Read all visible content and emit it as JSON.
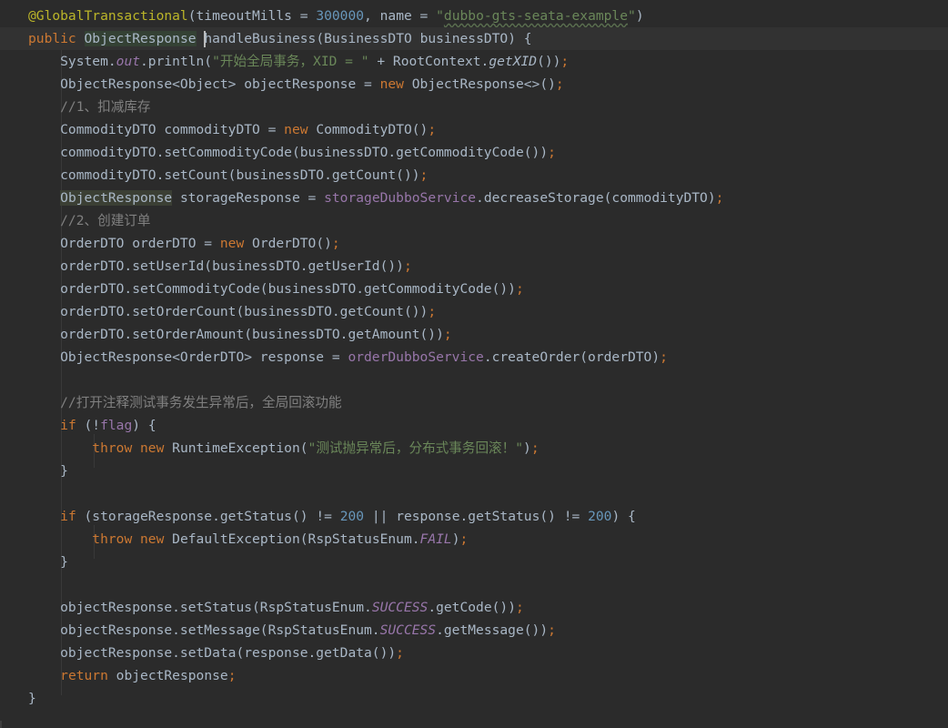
{
  "editor": {
    "theme_colors": {
      "background": "#2b2b2b",
      "keyword": "#cc7832",
      "string": "#6a8759",
      "number": "#6897bb",
      "annotation": "#bbb529",
      "comment": "#808080",
      "field": "#9876aa",
      "plain": "#a9b7c6"
    },
    "lines": [
      [
        {
          "t": "@GlobalTransactional",
          "c": "ann"
        },
        {
          "t": "(timeoutMills = ",
          "c": "plain"
        },
        {
          "t": "300000",
          "c": "num"
        },
        {
          "t": ", name = ",
          "c": "plain"
        },
        {
          "t": "\"",
          "c": "str"
        },
        {
          "t": "dubbo-gts-seata-example",
          "c": "url"
        },
        {
          "t": "\"",
          "c": "str"
        },
        {
          "t": ")",
          "c": "plain"
        }
      ],
      [
        {
          "t": "public ",
          "c": "kw"
        },
        {
          "t": "ObjectResponse",
          "c": "plain hlb"
        },
        {
          "t": " ",
          "c": "plain"
        },
        {
          "t": "",
          "c": "caret"
        },
        {
          "t": "handleBusiness",
          "c": "plain"
        },
        {
          "t": "(BusinessDTO businessDTO) {",
          "c": "plain"
        }
      ],
      [
        {
          "t": "    System.",
          "c": "plain"
        },
        {
          "t": "out",
          "c": "static"
        },
        {
          "t": ".println(",
          "c": "plain"
        },
        {
          "t": "\"开始全局事务，XID = \"",
          "c": "str"
        },
        {
          "t": " + RootContext.",
          "c": "plain"
        },
        {
          "t": "getXID",
          "c": "sitalic"
        },
        {
          "t": "())",
          "c": "plain"
        },
        {
          "t": ";",
          "c": "kw"
        }
      ],
      [
        {
          "t": "    ObjectResponse<Object> objectResponse = ",
          "c": "plain"
        },
        {
          "t": "new ",
          "c": "kw"
        },
        {
          "t": "ObjectResponse<>()",
          "c": "plain"
        },
        {
          "t": ";",
          "c": "kw"
        }
      ],
      [
        {
          "t": "    //1、扣减库存",
          "c": "cmt"
        }
      ],
      [
        {
          "t": "    CommodityDTO commodityDTO = ",
          "c": "plain"
        },
        {
          "t": "new ",
          "c": "kw"
        },
        {
          "t": "CommodityDTO()",
          "c": "plain"
        },
        {
          "t": ";",
          "c": "kw"
        }
      ],
      [
        {
          "t": "    commodityDTO.setCommodityCode(businessDTO.getCommodityCode())",
          "c": "plain"
        },
        {
          "t": ";",
          "c": "kw"
        }
      ],
      [
        {
          "t": "    commodityDTO.setCount(businessDTO.getCount())",
          "c": "plain"
        },
        {
          "t": ";",
          "c": "kw"
        }
      ],
      [
        {
          "t": "    ",
          "c": "plain"
        },
        {
          "t": "ObjectResponse",
          "c": "plain hl"
        },
        {
          "t": " storageResponse = ",
          "c": "plain"
        },
        {
          "t": "storageDubboService",
          "c": "field"
        },
        {
          "t": ".decreaseStorage(commodityDTO)",
          "c": "plain"
        },
        {
          "t": ";",
          "c": "kw"
        }
      ],
      [
        {
          "t": "    //2、创建订单",
          "c": "cmt"
        }
      ],
      [
        {
          "t": "    OrderDTO orderDTO = ",
          "c": "plain"
        },
        {
          "t": "new ",
          "c": "kw"
        },
        {
          "t": "OrderDTO()",
          "c": "plain"
        },
        {
          "t": ";",
          "c": "kw"
        }
      ],
      [
        {
          "t": "    orderDTO.setUserId(businessDTO.getUserId())",
          "c": "plain"
        },
        {
          "t": ";",
          "c": "kw"
        }
      ],
      [
        {
          "t": "    orderDTO.setCommodityCode(businessDTO.getCommodityCode())",
          "c": "plain"
        },
        {
          "t": ";",
          "c": "kw"
        }
      ],
      [
        {
          "t": "    orderDTO.setOrderCount(businessDTO.getCount())",
          "c": "plain"
        },
        {
          "t": ";",
          "c": "kw"
        }
      ],
      [
        {
          "t": "    orderDTO.setOrderAmount(businessDTO.getAmount())",
          "c": "plain"
        },
        {
          "t": ";",
          "c": "kw"
        }
      ],
      [
        {
          "t": "    ObjectResponse<OrderDTO> response = ",
          "c": "plain"
        },
        {
          "t": "orderDubboService",
          "c": "field"
        },
        {
          "t": ".createOrder(orderDTO)",
          "c": "plain"
        },
        {
          "t": ";",
          "c": "kw"
        }
      ],
      [],
      [
        {
          "t": "    //打开注释测试事务发生异常后，全局回滚功能",
          "c": "cmt"
        }
      ],
      [
        {
          "t": "    ",
          "c": "plain"
        },
        {
          "t": "if ",
          "c": "kw"
        },
        {
          "t": "(!",
          "c": "plain"
        },
        {
          "t": "flag",
          "c": "field"
        },
        {
          "t": ") {",
          "c": "plain"
        }
      ],
      [
        {
          "t": "        ",
          "c": "plain"
        },
        {
          "t": "throw new ",
          "c": "kw"
        },
        {
          "t": "RuntimeException(",
          "c": "plain"
        },
        {
          "t": "\"测试抛异常后，分布式事务回滚！\"",
          "c": "str"
        },
        {
          "t": ")",
          "c": "plain"
        },
        {
          "t": ";",
          "c": "kw"
        }
      ],
      [
        {
          "t": "    }",
          "c": "plain"
        }
      ],
      [],
      [
        {
          "t": "    ",
          "c": "plain"
        },
        {
          "t": "if ",
          "c": "kw"
        },
        {
          "t": "(storageResponse.getStatus() != ",
          "c": "plain"
        },
        {
          "t": "200 ",
          "c": "num"
        },
        {
          "t": "|| response.getStatus() != ",
          "c": "plain"
        },
        {
          "t": "200",
          "c": "num"
        },
        {
          "t": ") {",
          "c": "plain"
        }
      ],
      [
        {
          "t": "        ",
          "c": "plain"
        },
        {
          "t": "throw new ",
          "c": "kw"
        },
        {
          "t": "DefaultException(RspStatusEnum.",
          "c": "plain"
        },
        {
          "t": "FAIL",
          "c": "static"
        },
        {
          "t": ")",
          "c": "plain"
        },
        {
          "t": ";",
          "c": "kw"
        }
      ],
      [
        {
          "t": "    }",
          "c": "plain"
        }
      ],
      [],
      [
        {
          "t": "    objectResponse.setStatus(RspStatusEnum.",
          "c": "plain"
        },
        {
          "t": "SUCCESS",
          "c": "static"
        },
        {
          "t": ".getCode())",
          "c": "plain"
        },
        {
          "t": ";",
          "c": "kw"
        }
      ],
      [
        {
          "t": "    objectResponse.setMessage(RspStatusEnum.",
          "c": "plain"
        },
        {
          "t": "SUCCESS",
          "c": "static"
        },
        {
          "t": ".getMessage())",
          "c": "plain"
        },
        {
          "t": ";",
          "c": "kw"
        }
      ],
      [
        {
          "t": "    objectResponse.setData(response.getData())",
          "c": "plain"
        },
        {
          "t": ";",
          "c": "kw"
        }
      ],
      [
        {
          "t": "    ",
          "c": "plain"
        },
        {
          "t": "return ",
          "c": "kw"
        },
        {
          "t": "objectResponse",
          "c": "plain"
        },
        {
          "t": ";",
          "c": "kw"
        }
      ],
      [
        {
          "t": "}",
          "c": "plain"
        }
      ]
    ]
  }
}
